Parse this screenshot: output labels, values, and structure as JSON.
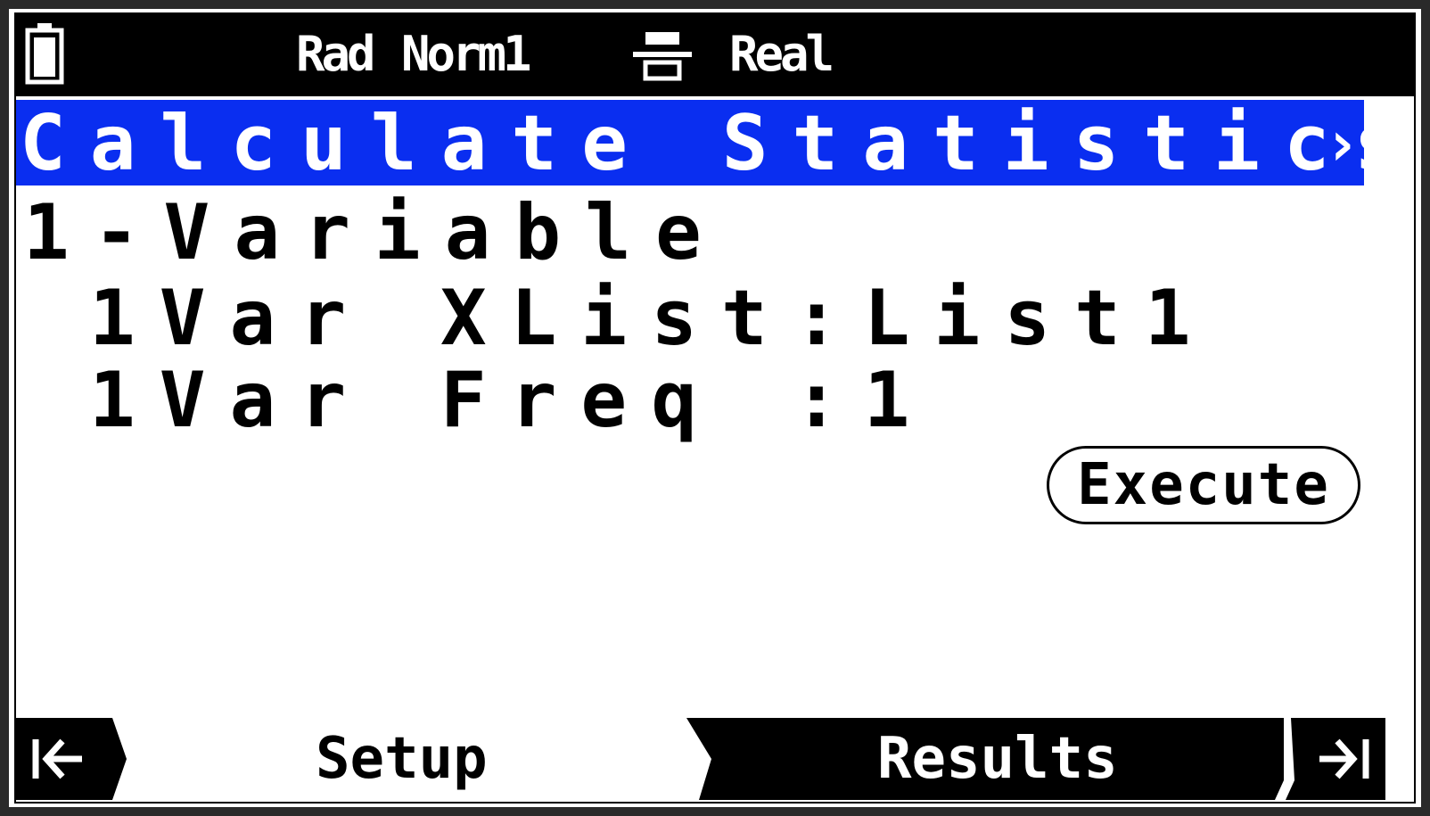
{
  "status_bar": {
    "angle_mode": "Rad",
    "display_mode": "Norm1",
    "input_mode_icon": "math-input-icon",
    "complex_mode": "Real",
    "battery_icon": "battery-icon"
  },
  "title": {
    "text": "Calculate Statistics",
    "arrow": "›"
  },
  "calc_type": "1-Variable",
  "settings": [
    {
      "label": "1Var XList",
      "value": ":List1"
    },
    {
      "label": "1Var Freq",
      "value": ":1"
    }
  ],
  "execute_label": "Execute",
  "tabs": {
    "prev_icon": "first-tab-arrow-icon",
    "setup_label": "Setup",
    "results_label": "Results",
    "next_icon": "last-tab-arrow-icon",
    "active": "Setup"
  },
  "colors": {
    "title_background": "#0a2ef0",
    "status_background": "#000000",
    "screen_background": "#ffffff"
  }
}
